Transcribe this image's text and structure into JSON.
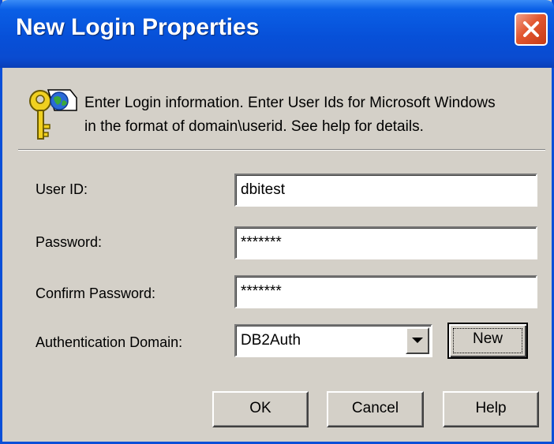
{
  "window": {
    "title": "New Login Properties"
  },
  "header": {
    "icon": "key-globe-icon",
    "info_line1": "Enter Login information. Enter User Ids for Microsoft Windows",
    "info_line2": "in the format of domain\\userid. See help for details."
  },
  "form": {
    "user_id_label": "User ID:",
    "user_id_value": "dbitest",
    "password_label": "Password:",
    "password_value": "*******",
    "confirm_label": "Confirm Password:",
    "confirm_value": "*******",
    "domain_label": "Authentication Domain:",
    "domain_value": "DB2Auth",
    "new_button": "New"
  },
  "buttons": {
    "ok": "OK",
    "cancel": "Cancel",
    "help": "Help"
  },
  "colors": {
    "titlebar": "#0750d8",
    "close": "#e2562e",
    "dialog_bg": "#d4d0c8"
  }
}
